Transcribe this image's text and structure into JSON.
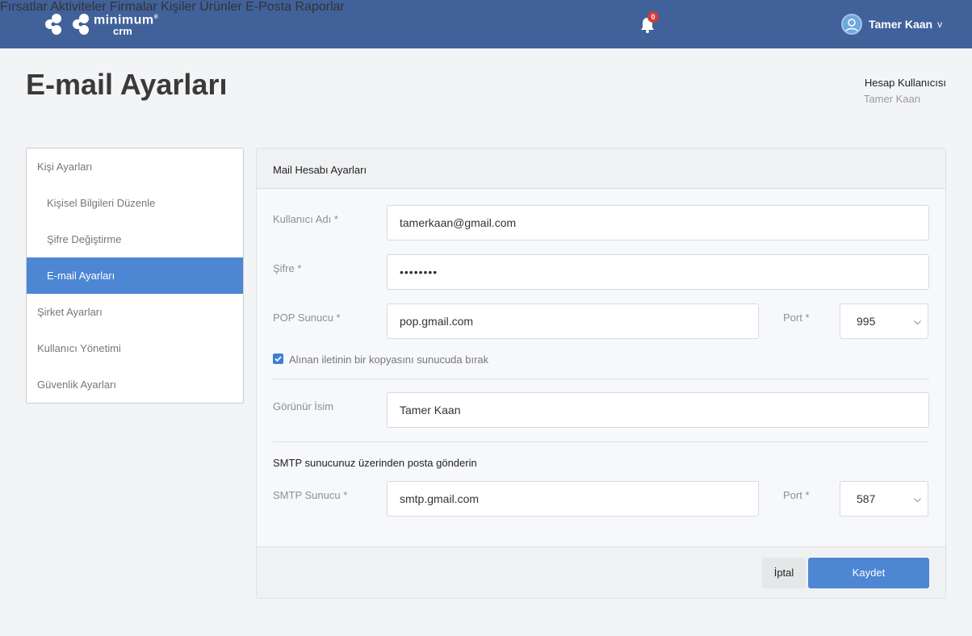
{
  "brand": {
    "line1": "minimum",
    "line2": "crm",
    "mark": "®"
  },
  "nav": {
    "items": [
      "Fırsatlar",
      "Aktiviteler",
      "Firmalar",
      "Kişiler",
      "Ürünler",
      "E-Posta",
      "Raporlar"
    ],
    "notifications_count": "0"
  },
  "user": {
    "name": "Tamer Kaan",
    "chevron": "v"
  },
  "page": {
    "title": "E-mail Ayarları",
    "account_label": "Hesap Kullanıcısı",
    "account_name": "Tamer Kaan"
  },
  "sidebar": {
    "items": [
      {
        "label": "Kişi Ayarları"
      },
      {
        "label": "Kişisel Bilgileri Düzenle"
      },
      {
        "label": "Şifre Değiştirme"
      },
      {
        "label": "E-mail Ayarları"
      },
      {
        "label": "Şirket Ayarları"
      },
      {
        "label": "Kullanıcı Yönetimi"
      },
      {
        "label": "Güvenlik Ayarları"
      }
    ]
  },
  "form": {
    "panel_title": "Mail Hesabı Ayarları",
    "username_label": "Kullanıcı Adı *",
    "username_value": "tamerkaan@gmail.com",
    "password_label": "Şifre *",
    "password_value": "••••••••",
    "pop_label": "POP Sunucu *",
    "pop_value": "pop.gmail.com",
    "pop_port_label": "Port *",
    "pop_port_value": "995",
    "keep_copy_label": "Alınan iletinin bir kopyasını sunucuda bırak",
    "keep_copy_checked": true,
    "display_name_label": "Görünür İsim",
    "display_name_value": "Tamer Kaan",
    "smtp_section_title": "SMTP sunucunuz üzerinden posta gönderin",
    "smtp_label": "SMTP Sunucu *",
    "smtp_value": "smtp.gmail.com",
    "smtp_port_label": "Port *",
    "smtp_port_value": "587"
  },
  "actions": {
    "cancel_label": "İptal",
    "save_label": "Kaydet"
  },
  "colors": {
    "topbar": "#40619a",
    "accent": "#4d86d3",
    "badge": "#d33b3b"
  }
}
